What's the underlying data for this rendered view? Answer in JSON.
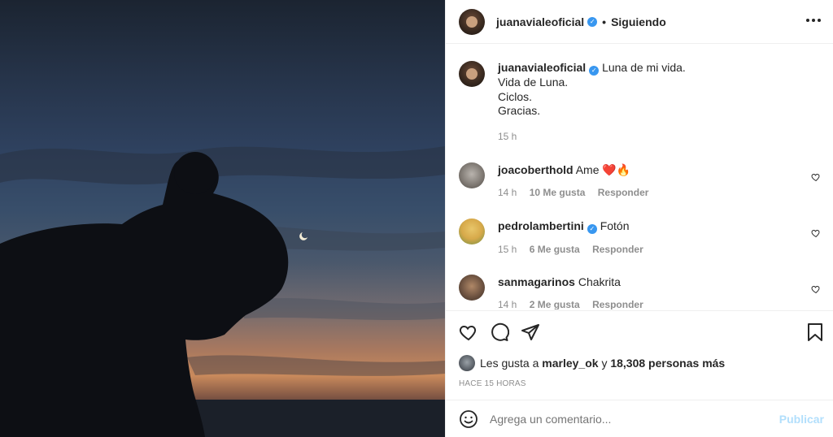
{
  "post": {
    "author": "juanavialeoficial",
    "follow_status": "Siguiendo",
    "caption_lines": [
      "Luna de mi vida.",
      "Vida de Luna.",
      "Ciclos.",
      "Gracias."
    ],
    "caption_time": "15 h"
  },
  "comments": [
    {
      "user": "joacoberthold",
      "text": "Ame",
      "emojis": "❤️🔥",
      "time": "14 h",
      "likes": "10 Me gusta",
      "reply": "Responder"
    },
    {
      "user": "pedrolambertini",
      "text": "Fotón",
      "verified": true,
      "time": "15 h",
      "likes": "6 Me gusta",
      "reply": "Responder"
    },
    {
      "user": "sanmagarinos",
      "text": "Chakrita",
      "time": "14 h",
      "likes": "2 Me gusta",
      "reply": "Responder"
    }
  ],
  "likes": {
    "prefix": "Les gusta a",
    "user": "marley_ok",
    "connector": "y",
    "rest": "18,308 personas más"
  },
  "posted_ago": "HACE 15 HORAS",
  "add_comment": {
    "placeholder": "Agrega un comentario...",
    "post_label": "Publicar"
  },
  "icons": {
    "verified": "verified-badge",
    "like": "heart-icon",
    "comment": "comment-icon",
    "share": "share-icon",
    "save": "bookmark-icon",
    "emoji": "emoji-icon",
    "more": "more-options-icon"
  },
  "colors": {
    "verified": "#3897f0",
    "post_button_disabled": "#b2dffc",
    "muted_text": "#8e8e8e"
  }
}
